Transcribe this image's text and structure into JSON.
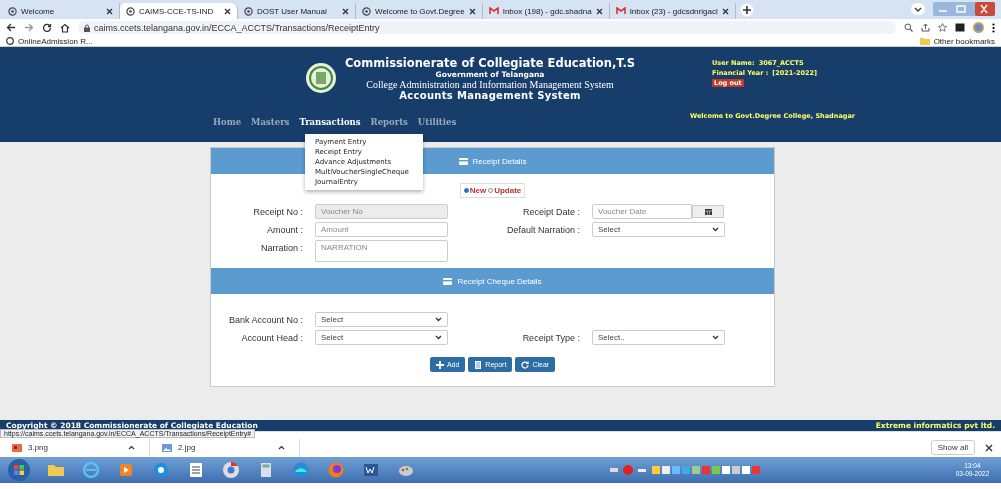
{
  "browser": {
    "tabs": [
      {
        "title": "Welcome",
        "kind": "site",
        "selected": false
      },
      {
        "title": "CAIMS-CCE-TS-IND",
        "kind": "site",
        "selected": true
      },
      {
        "title": "DOST User Manual",
        "kind": "site",
        "selected": false
      },
      {
        "title": "Welcome to Govt.Degree",
        "kind": "site",
        "selected": false
      },
      {
        "title": "Inbox (198) - gdc.shadna",
        "kind": "mail",
        "selected": false
      },
      {
        "title": "Inbox (23) - gdcsdnrigacl",
        "kind": "mail",
        "selected": false
      }
    ],
    "address": "caims.ccets.telangana.gov.in/ECCA_ACCTS/Transactions/ReceiptEntry",
    "bookmarks": [
      "OnlineAdmission R..."
    ],
    "other_bookmarks": "Other bookmarks"
  },
  "header": {
    "title": "Commissionerate of Collegiate Education,T.S",
    "subtitle": "Government of Telangana",
    "system": "College Administration and Information Management System",
    "module": "Accounts Management System",
    "user_name_label": "User Name:",
    "user_name": "3067_ACCTS",
    "financial_year_label": "Financial Year :",
    "financial_year": "[2021-2022]",
    "logout": "Log out",
    "welcome": "Welcome to  Govt.Degree College, Shadnagar"
  },
  "nav": [
    {
      "label": "Home",
      "selected": false
    },
    {
      "label": "Masters",
      "selected": false
    },
    {
      "label": "Transactions",
      "selected": true
    },
    {
      "label": "Reports",
      "selected": false
    },
    {
      "label": "Utilities",
      "selected": false
    }
  ],
  "dropdown_menu": [
    "Payment Entry",
    "Receipt Entry",
    "Advance Adjustments",
    "MultiVoucherSingleCheque",
    "JournalEntry"
  ],
  "receipt_details": {
    "heading": "Receipt Details",
    "modes": [
      {
        "label": "New",
        "selected": true
      },
      {
        "label": "Update",
        "selected": false
      }
    ],
    "rows": [
      [
        {
          "label": "Receipt No :",
          "kind": "input",
          "placeholder": "Voucher No",
          "disabled": true
        },
        {
          "label": "Receipt Date :",
          "kind": "date",
          "placeholder": "Voucher Date",
          "disabled": false
        }
      ],
      [
        {
          "label": "Amount :",
          "kind": "input",
          "placeholder": "Amount",
          "disabled": false
        },
        {
          "label": "Default Narration :",
          "kind": "select",
          "value": "Select",
          "disabled": false
        }
      ],
      [
        {
          "label": "Narration :",
          "kind": "textarea",
          "placeholder": "NARRATION",
          "disabled": false
        }
      ]
    ]
  },
  "cheque_details": {
    "heading": "Receipt Cheque Details",
    "rows": [
      [
        {
          "label": "Bank Account No :",
          "kind": "select",
          "value": "Select",
          "disabled": false
        }
      ],
      [
        {
          "label": "Account Head :",
          "kind": "select",
          "value": "Select",
          "disabled": false
        },
        {
          "label": "Receipt Type :",
          "kind": "select",
          "value": "Select..",
          "disabled": false
        }
      ]
    ],
    "buttons": [
      {
        "label": "Add",
        "kind": "add"
      },
      {
        "label": "Report",
        "kind": "report"
      },
      {
        "label": "Clear",
        "kind": "clear"
      }
    ]
  },
  "footer": {
    "copyright": "Copyright © 2018 Commissionerate of Collegiate Education",
    "vendor": "Extreme informatics pvt ltd."
  },
  "status_url": "https://caims.ccets.telangana.gov.in/ECCA_ACCTS/Transactions/ReceiptEntry#",
  "downloads": {
    "files": [
      {
        "name": "3.png",
        "kind": "png"
      },
      {
        "name": "2.jpg",
        "kind": "jpg"
      }
    ],
    "show_all": "Show all"
  },
  "taskbar": {
    "time": "13:04",
    "date": "03-09-2022"
  }
}
